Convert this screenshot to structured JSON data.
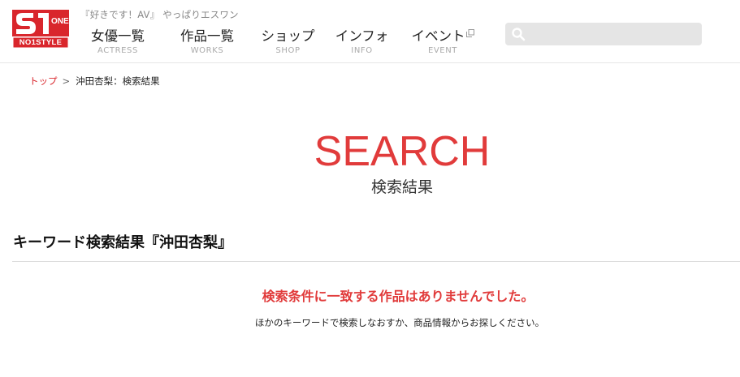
{
  "header": {
    "logo_text_top": "S ONE",
    "logo_text_bottom": "NO1STYLE",
    "tagline": "『好きです！AV』 やっぱりエスワン",
    "nav": [
      {
        "ja": "女優一覧",
        "en": "ACTRESS"
      },
      {
        "ja": "作品一覧",
        "en": "WORKS"
      },
      {
        "ja": "ショップ",
        "en": "SHOP"
      },
      {
        "ja": "インフォ",
        "en": "INFO"
      },
      {
        "ja": "イベント",
        "en": "EVENT"
      }
    ],
    "search": {
      "value": "",
      "placeholder": ""
    }
  },
  "breadcrumb": {
    "home": "トップ",
    "separator": ">",
    "current": "沖田杏梨：検索結果"
  },
  "hero": {
    "title": "SEARCH",
    "subtitle": "検索結果"
  },
  "results": {
    "heading": "キーワード検索結果『沖田杏梨』",
    "empty_message": "検索条件に一致する作品はありませんでした。",
    "empty_hint": "ほかのキーワードで検索しなおすか、商品情報からお探しください。"
  },
  "colors": {
    "brand_red": "#d9262c",
    "accent_red": "#e13b3b",
    "search_bg": "#e5e5e5"
  }
}
